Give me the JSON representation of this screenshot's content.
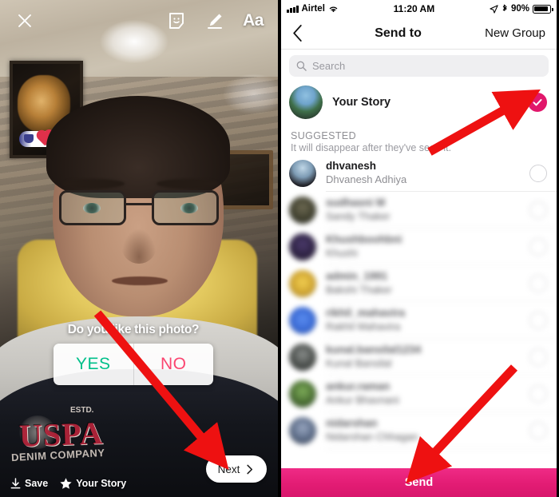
{
  "left_panel": {
    "topbar": {
      "close_label": "×",
      "sticker_icon": "sticker-icon",
      "draw_icon": "pen-icon",
      "text_label": "Aa"
    },
    "poll": {
      "question": "Do you like this photo?",
      "option_yes": "YES",
      "option_no": "NO",
      "yes_color": "#00c08a",
      "no_color": "#fb4570"
    },
    "bottom": {
      "save_label": "Save",
      "your_story_label": "Your Story",
      "next_label": "Next"
    }
  },
  "right_panel": {
    "statusbar": {
      "carrier": "Airtel",
      "time": "11:20 AM",
      "battery_percent": "90%"
    },
    "navbar": {
      "back_icon": "chevron-left-icon",
      "title": "Send to",
      "action": "New Group"
    },
    "search": {
      "placeholder": "Search",
      "value": ""
    },
    "your_story": {
      "label": "Your Story",
      "selected": true,
      "check_color": "#e1176b"
    },
    "section": {
      "title": "SUGGESTED",
      "subtitle": "It will disappear after they've seen it."
    },
    "contacts": [
      {
        "username": "dhvanesh",
        "fullname": "Dhvanesh Adhiya",
        "selected": false,
        "blurred": false
      },
      {
        "username": "sudhasni M",
        "fullname": "Sandy Thaker",
        "selected": false,
        "blurred": true
      },
      {
        "username": "Khushboohbni",
        "fullname": "Khushi",
        "selected": false,
        "blurred": true
      },
      {
        "username": "admin_1991",
        "fullname": "Bakshi Thaker",
        "selected": false,
        "blurred": true
      },
      {
        "username": "rikhil_mahavira",
        "fullname": "Rakhil Mahavira",
        "selected": false,
        "blurred": true
      },
      {
        "username": "kunal.bansilal1234",
        "fullname": "Kunal Bansilal",
        "selected": false,
        "blurred": true
      },
      {
        "username": "ankur.raman",
        "fullname": "Ankur Bhavnani",
        "selected": false,
        "blurred": true
      },
      {
        "username": "nidarshan",
        "fullname": "Nidarshan Chhagan",
        "selected": false,
        "blurred": true
      }
    ],
    "send_button": {
      "label": "Send",
      "color": "#e31c74"
    }
  },
  "annotations": {
    "arrow_color": "#ee1111",
    "arrow_to_next_button": "points at Next button",
    "arrow_to_story_check": "points at Your Story selected checkmark",
    "arrow_to_send": "points at Send button"
  }
}
